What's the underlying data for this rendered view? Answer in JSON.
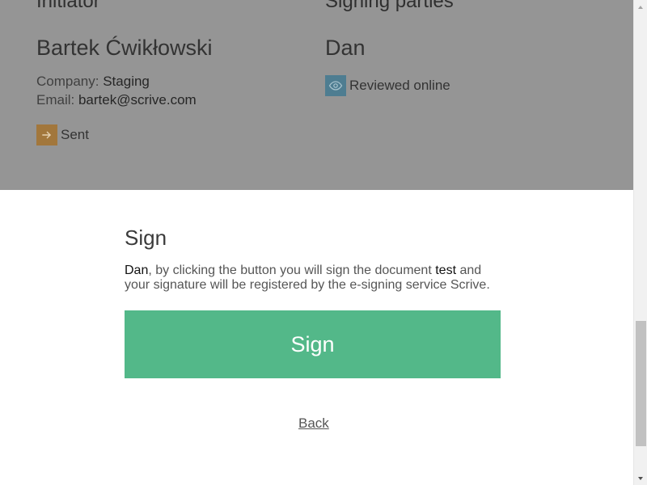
{
  "initiator": {
    "heading": "Initiator",
    "name": "Bartek Ćwikłowski",
    "company_label": "Company:",
    "company_value": "Staging",
    "email_label": "Email:",
    "email_value": "bartek@scrive.com",
    "status": {
      "label": "Sent",
      "icon": "arrow-right-icon",
      "color": "#a2773c"
    }
  },
  "signing_parties": {
    "heading": "Signing parties",
    "party_name": "Dan",
    "status": {
      "label": "Reviewed online",
      "icon": "eye-icon",
      "color": "#4e7d91"
    }
  },
  "sign_panel": {
    "title": "Sign",
    "message": {
      "signer_name": "Dan",
      "before_document": ", by clicking the button you will sign the document ",
      "document_name": "test",
      "after_document": " and your signature will be registered by the e-signing service Scrive."
    },
    "sign_button_label": "Sign",
    "back_link_label": "Back",
    "button_color": "#53b889"
  },
  "theme": {
    "overlay_color": "#959595"
  },
  "scrollbar": {
    "up_icon": "scroll-up-icon",
    "down_icon": "scroll-down-icon"
  }
}
